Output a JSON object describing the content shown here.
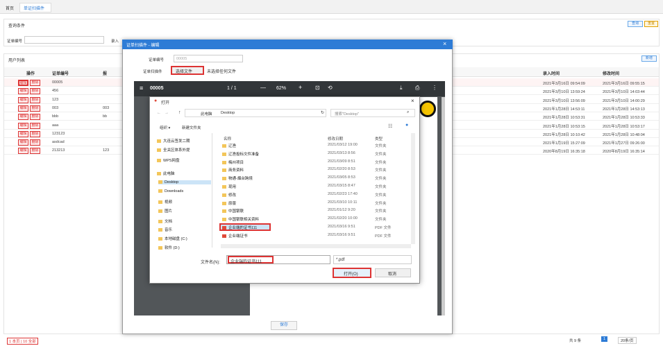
{
  "top_tabs": {
    "home": "首页",
    "current": "单证扫描件"
  },
  "query_section": {
    "title": "查询条件",
    "field_doc_no": "证单编号",
    "field_entry": "录入",
    "btn_query": "查询",
    "btn_reset": "重置"
  },
  "list_section": {
    "title": "用户列表",
    "btn_add": "新增",
    "columns": {
      "op": "操作",
      "doc_no": "证单编号",
      "col3": "报",
      "entry_time": "录入时间",
      "mod_time": "修改时间"
    },
    "edit_label": "编辑",
    "delete_label": "删除",
    "rows": [
      {
        "doc": "00005",
        "c3": "",
        "entry": "2021年3月16日 09:54:09",
        "mod": "2021年3月16日 09:55:15"
      },
      {
        "doc": "456",
        "c3": "",
        "entry": "2021年3月10日 13:59:24",
        "mod": "2021年3月10日 14:03:44"
      },
      {
        "doc": "123",
        "c3": "",
        "entry": "2021年3月10日 13:56:09",
        "mod": "2021年3月10日 14:00:29"
      },
      {
        "doc": "003",
        "c3": "003",
        "entry": "2021年1月28日 14:53:11",
        "mod": "2021年1月28日 14:53:13"
      },
      {
        "doc": "bbb",
        "c3": "bb",
        "entry": "2021年1月28日 10:53:31",
        "mod": "2021年1月28日 10:53:33"
      },
      {
        "doc": "aaa",
        "c3": "",
        "entry": "2021年1月28日 10:53:15",
        "mod": "2021年1月28日 10:53:17"
      },
      {
        "doc": "123123",
        "c3": "",
        "entry": "2021年1月28日 10:10:42",
        "mod": "2021年1月28日 10:48:04"
      },
      {
        "doc": "asdcad",
        "c3": "",
        "entry": "2021年1月19日 15:27:09",
        "mod": "2021年1月27日 09:26:00"
      },
      {
        "doc": "213213",
        "c3": "123",
        "entry": "2020年8月19日 16:35:18",
        "mod": "2020年8月19日 16:35:14"
      }
    ],
    "footer_left": "1 本页 | 10 全部",
    "footer_right": "共 9 条",
    "page_num": "1",
    "per_page": "20条/页"
  },
  "dialog": {
    "title": "证单扫描件 - 编辑",
    "doc_no_label": "证单编号",
    "doc_no_value": "00005",
    "file_label": "证单扫描件",
    "choose_file": "选择文件",
    "no_file": "未选择任何文件",
    "save": "保存",
    "pdf": {
      "name": "00005",
      "page": "1 / 1",
      "zoom": "62%"
    }
  },
  "file_dialog": {
    "title": "打开",
    "path": [
      "此电脑",
      "Desktop"
    ],
    "search_placeholder": "搜索\"Desktop\"",
    "organize": "组织 ▾",
    "new_folder": "新建文件夹",
    "nav_items": [
      "大连云签发二期",
      "全关区体系外提",
      "WPS网盘",
      "此电脑",
      "Desktop",
      "Downloads",
      "视频",
      "图片",
      "文档",
      "音乐",
      "本地磁盘 (C:)",
      "软件 (D:)"
    ],
    "cols": {
      "name": "名称",
      "date": "修改日期",
      "type": "类型"
    },
    "files": [
      {
        "name": "辽渔",
        "date": "2021/03/12 19:00",
        "type": "文件夹"
      },
      {
        "name": "辽渔投标文件准备",
        "date": "2021/03/13 8:56",
        "type": "文件夹"
      },
      {
        "name": "梅州项目",
        "date": "2021/03/09 8:51",
        "type": "文件夹"
      },
      {
        "name": "商务资料",
        "date": "2021/02/20 8:53",
        "type": "文件夹"
      },
      {
        "name": "物通-烟台跨境",
        "date": "2021/03/05 8:53",
        "type": "文件夹"
      },
      {
        "name": "现用",
        "date": "2021/03/15 8:47",
        "type": "文件夹"
      },
      {
        "name": "修改",
        "date": "2021/02/23 17:40",
        "type": "文件夹"
      },
      {
        "name": "原版",
        "date": "2021/03/10 10:11",
        "type": "文件夹"
      },
      {
        "name": "中国银联",
        "date": "2021/01/12 9:20",
        "type": "文件夹"
      },
      {
        "name": "中国银联相关资料",
        "date": "2021/02/20 10:00",
        "type": "文件夹"
      },
      {
        "name": "企业端的证书111",
        "date": "2021/03/16 9:51",
        "type": "PDF 文件"
      },
      {
        "name": "企业端证书",
        "date": "2021/03/16 9:51",
        "type": "PDF 文件"
      }
    ],
    "filename_label": "文件名(N):",
    "filename_value": "企业端的证书111",
    "filter": "*.pdf",
    "open": "打开(O)",
    "cancel": "取消"
  },
  "colors": {
    "dialog_title": "#2e7cd6",
    "pdf_bar": "#323639",
    "highlight": "#d33"
  }
}
